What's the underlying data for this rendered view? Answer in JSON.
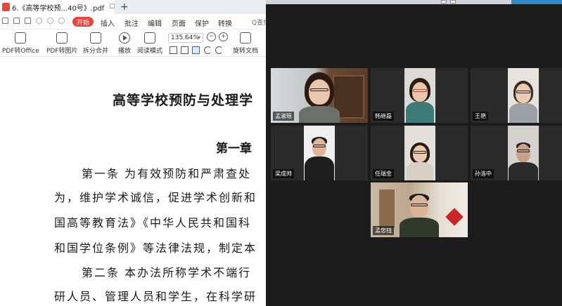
{
  "editor": {
    "tab_title": "6.《高等学校预...40号》.pdf",
    "tab_controls": "☐ ✕",
    "new_tab": "+",
    "menu": {
      "start_label": "开始",
      "items": [
        "插入",
        "批注",
        "编辑",
        "页面",
        "保护",
        "转换"
      ],
      "search_hint": "Q查找"
    },
    "toolbar": {
      "pdf_to_office": "PDF转Office",
      "pdf_to_image": "PDF转图片",
      "split_merge": "拆分合并",
      "play": "播放",
      "reading_mode": "阅读模式",
      "zoom": "135.64%",
      "rotate_doc": "旋转文档",
      "zoom_out": "−",
      "zoom_in": "+"
    },
    "document": {
      "title": "高等学校预防与处理学",
      "chapter": "第一章",
      "lines": [
        "第一条  为有效预防和严肃查处",
        "为，维护学术诚信，促进学术创新和",
        "国高等教育法》《中华人民共和国科",
        "和国学位条例》等法律法规，制定本",
        "第二条  本办法所称学术不端行",
        "研人员、管理人员和学生，在科学研"
      ]
    }
  },
  "meeting": {
    "participants": [
      {
        "name": "孟淑瑶"
      },
      {
        "name": "韩继磊"
      },
      {
        "name": "王艳"
      },
      {
        "name": "梁成帅"
      },
      {
        "name": "任瑞金"
      },
      {
        "name": "孙洛中"
      },
      {
        "name": "孟忠钰"
      }
    ]
  }
}
